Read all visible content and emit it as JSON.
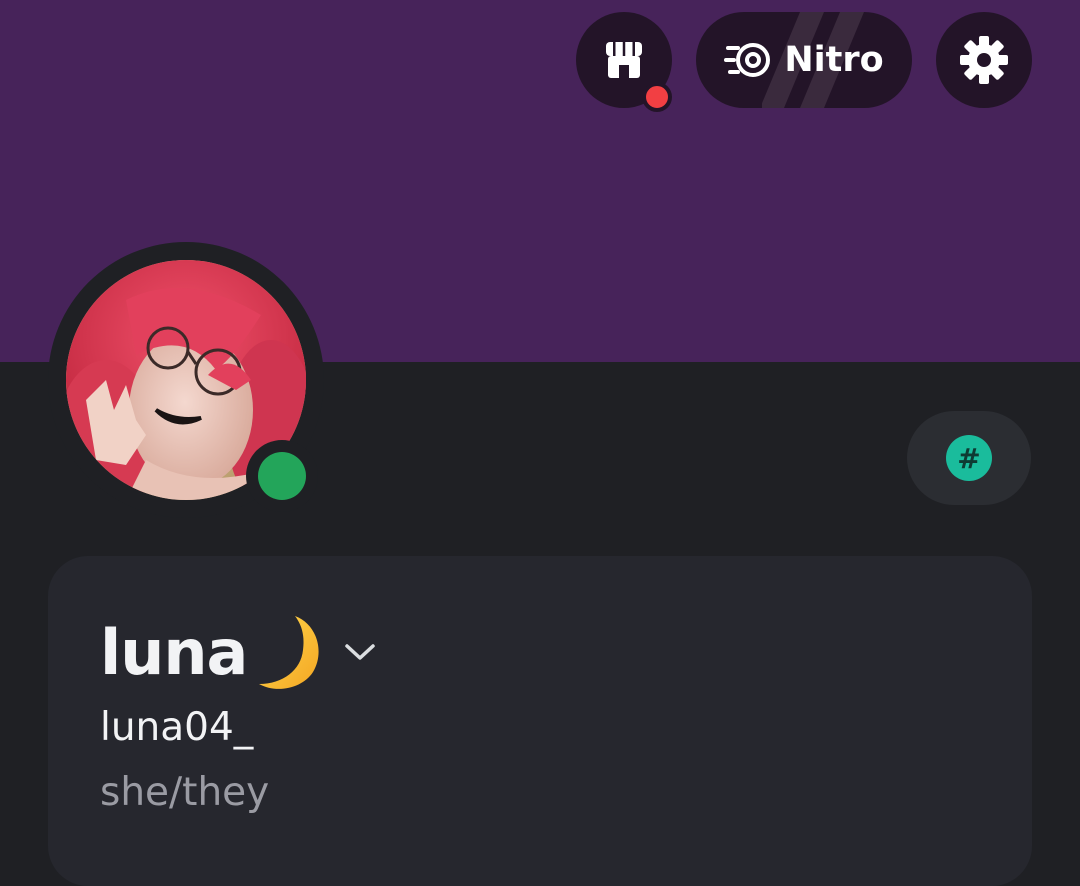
{
  "header": {
    "shop_icon": "shop-icon",
    "shop_has_notification": true,
    "nitro_label": "Nitro",
    "nitro_icon": "nitro-icon",
    "settings_icon": "gear-icon"
  },
  "profile": {
    "display_name": "luna",
    "display_name_emoji": "crescent-moon",
    "username": "luna04_",
    "pronouns": "she/they",
    "status": "online",
    "badge_icon": "hashtag-icon"
  },
  "colors": {
    "banner": "#47235a",
    "background": "#1f2024",
    "card": "#26272e",
    "online": "#23a55a",
    "notification": "#f23f43",
    "badge": "#1abc9c"
  }
}
